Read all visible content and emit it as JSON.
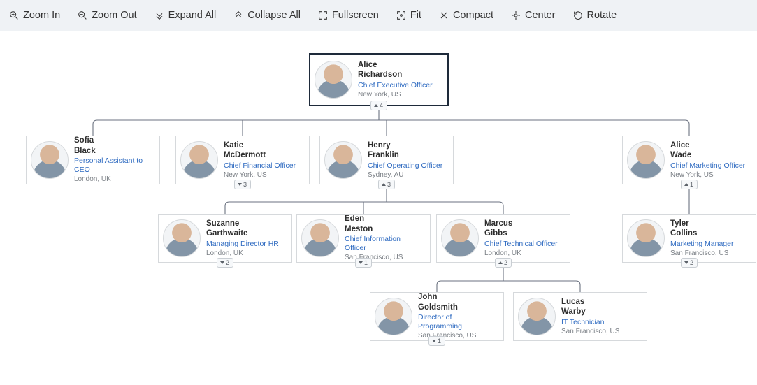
{
  "toolbar": {
    "zoom_in": "Zoom In",
    "zoom_out": "Zoom Out",
    "expand_all": "Expand All",
    "collapse_all": "Collapse All",
    "fullscreen": "Fullscreen",
    "fit": "Fit",
    "compact": "Compact",
    "center": "Center",
    "rotate": "Rotate"
  },
  "chart_data": {
    "type": "org-chart",
    "root": {
      "first": "Alice",
      "last": "Richardson",
      "title": "Chief Executive Officer",
      "location": "New York, US",
      "expand_dir": "up",
      "expand_count": 4
    },
    "level2": [
      {
        "first": "Sofia",
        "last": "Black",
        "title": "Personal Assistant to CEO",
        "location": "London, UK",
        "expand_count": null
      },
      {
        "first": "Katie",
        "last": "McDermott",
        "title": "Chief Financial Officer",
        "location": "New York, US",
        "expand_dir": "down",
        "expand_count": 3
      },
      {
        "first": "Henry",
        "last": "Franklin",
        "title": "Chief Operating Officer",
        "location": "Sydney, AU",
        "expand_dir": "up",
        "expand_count": 3
      },
      {
        "first": "Alice",
        "last": "Wade",
        "title": "Chief Marketing Officer",
        "location": "New York, US",
        "expand_dir": "up",
        "expand_count": 1
      }
    ],
    "level3_franklin": [
      {
        "first": "Suzanne",
        "last": "Garthwaite",
        "title": "Managing Director HR",
        "location": "London, UK",
        "expand_dir": "down",
        "expand_count": 2
      },
      {
        "first": "Eden",
        "last": "Meston",
        "title": "Chief Information Officer",
        "location": "San Francisco, US",
        "expand_dir": "down",
        "expand_count": 1
      },
      {
        "first": "Marcus",
        "last": "Gibbs",
        "title": "Chief Technical Officer",
        "location": "London, UK",
        "expand_dir": "up",
        "expand_count": 2
      }
    ],
    "level3_wade": [
      {
        "first": "Tyler",
        "last": "Collins",
        "title": "Marketing Manager",
        "location": "San Francisco, US",
        "expand_dir": "down",
        "expand_count": 2
      }
    ],
    "level4_gibbs": [
      {
        "first": "John",
        "last": "Goldsmith",
        "title": "Director of Programming",
        "location": "San Francisco, US",
        "expand_dir": "down",
        "expand_count": 1
      },
      {
        "first": "Lucas",
        "last": "Warby",
        "title": "IT Technician",
        "location": "San Francisco, US",
        "expand_count": null
      }
    ]
  }
}
